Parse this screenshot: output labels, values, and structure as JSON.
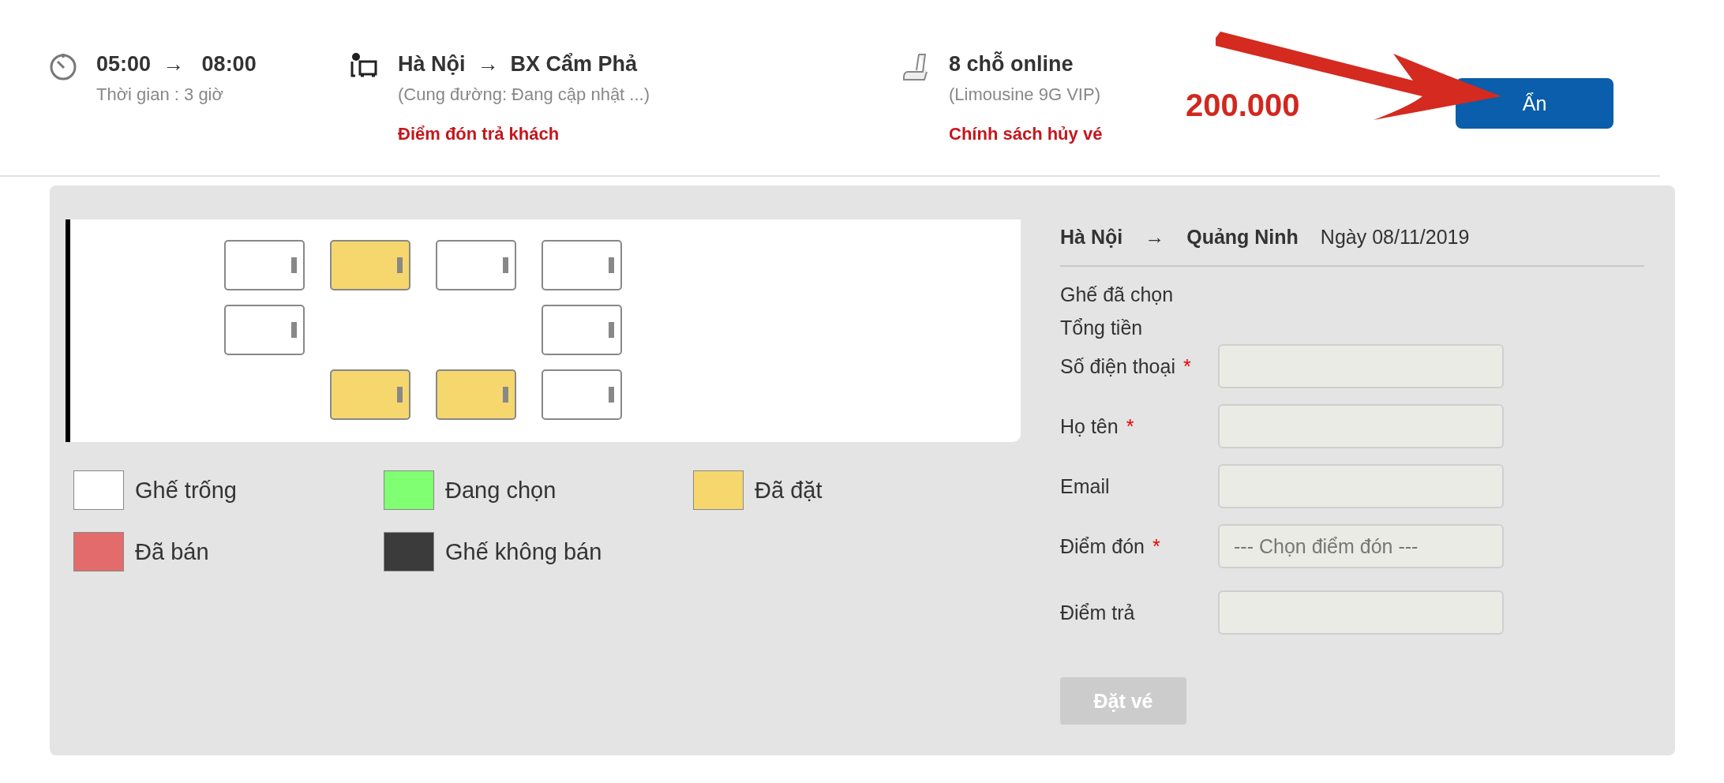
{
  "trip": {
    "depart": "05:00",
    "arrow": "→",
    "arrive": "08:00",
    "duration": "Thời gian : 3 giờ",
    "from": "Hà Nội",
    "route_arrow": "→",
    "to": "BX Cẩm Phả",
    "route_note": "(Cung đường: Đang cập nhật ...)",
    "pickup_link": "Điểm đón trả khách",
    "seats_online": "8  chỗ online",
    "vehicle": "(Limousine 9G VIP)",
    "policy_link": "Chính sách hủy vé",
    "price": "200.000",
    "toggle_button": "Ẩn"
  },
  "seat_map": {
    "rows": [
      [
        {
          "kind": "empty"
        },
        {
          "kind": "booked"
        },
        {
          "kind": "empty"
        },
        {
          "kind": "empty"
        }
      ],
      [
        {
          "kind": "empty"
        },
        {
          "kind": "gap"
        },
        {
          "kind": "gap"
        },
        {
          "kind": "empty"
        }
      ],
      [
        {
          "kind": "gap"
        },
        {
          "kind": "booked"
        },
        {
          "kind": "booked"
        },
        {
          "kind": "empty"
        }
      ]
    ]
  },
  "legend": [
    {
      "label": "Ghế trống",
      "color": "#ffffff"
    },
    {
      "label": "Đang chọn",
      "color": "#80ff72"
    },
    {
      "label": "Đã đặt",
      "color": "#f5d76e"
    },
    {
      "label": "Đã bán",
      "color": "#e46b6b"
    },
    {
      "label": "Ghế không bán",
      "color": "#3b3b3b"
    }
  ],
  "booking": {
    "from": "Hà Nội",
    "arrow": "→",
    "to": "Quảng Ninh",
    "date": "Ngày 08/11/2019",
    "selected_seats": "Ghế đã chọn",
    "total": "Tổng tiền",
    "fields": [
      {
        "label": "Số điện thoại",
        "required_mark": "*",
        "kind": "text"
      },
      {
        "label": "Họ tên",
        "required_mark": "*",
        "kind": "text"
      },
      {
        "label": "Email",
        "kind": "text"
      },
      {
        "label": "Điểm đón",
        "required_mark": "*",
        "kind": "select",
        "placeholder": "--- Chọn điểm đón ---"
      },
      {
        "label": "Điểm trả",
        "kind": "select"
      }
    ],
    "submit": "Đặt vé",
    "submit_disabled": true
  }
}
